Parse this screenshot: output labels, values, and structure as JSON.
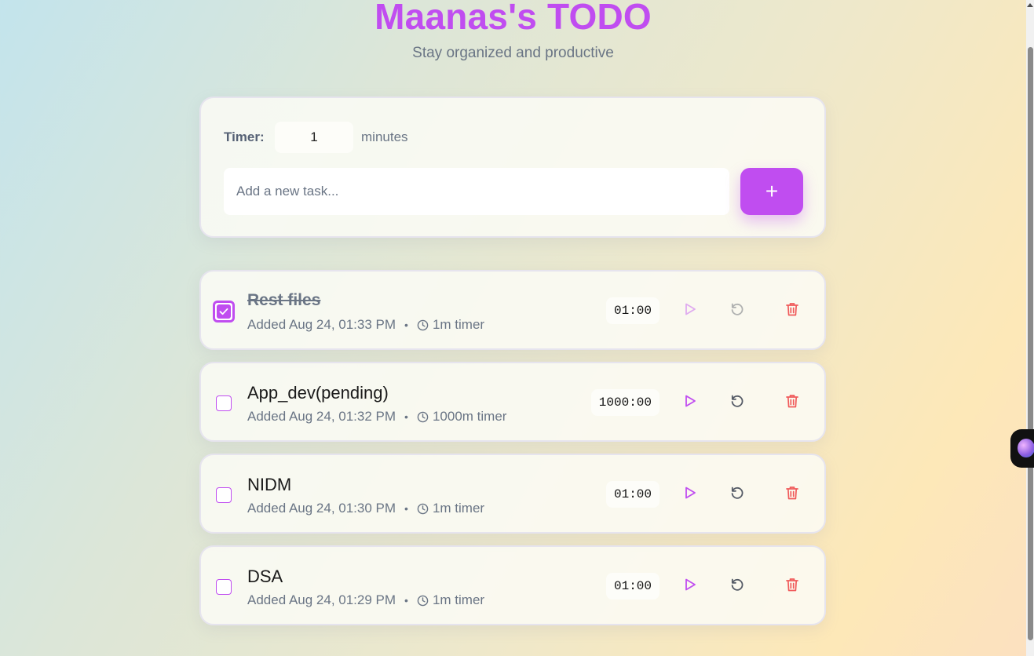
{
  "header": {
    "title": "Maanas's TODO",
    "subtitle": "Stay organized and productive"
  },
  "form": {
    "timer_label": "Timer:",
    "timer_value": "1",
    "timer_unit": "minutes",
    "task_placeholder": "Add a new task...",
    "add_label": "+"
  },
  "tasks": [
    {
      "title": "Rest files",
      "added": "Added Aug 24, 01:33 PM",
      "timer": "1m timer",
      "countdown": "01:00",
      "completed": true
    },
    {
      "title": "App_dev(pending)",
      "added": "Added Aug 24, 01:32 PM",
      "timer": "1000m timer",
      "countdown": "1000:00",
      "completed": false
    },
    {
      "title": "NIDM",
      "added": "Added Aug 24, 01:30 PM",
      "timer": "1m timer",
      "countdown": "01:00",
      "completed": false
    },
    {
      "title": "DSA",
      "added": "Added Aug 24, 01:29 PM",
      "timer": "1m timer",
      "countdown": "01:00",
      "completed": false
    }
  ],
  "icons": {
    "play": "play-icon",
    "reset": "reset-icon",
    "delete": "trash-icon",
    "clock": "clock-icon",
    "check": "check-icon"
  },
  "colors": {
    "accent": "#c04df0",
    "delete": "#f05a5a",
    "muted": "#6a7585"
  }
}
